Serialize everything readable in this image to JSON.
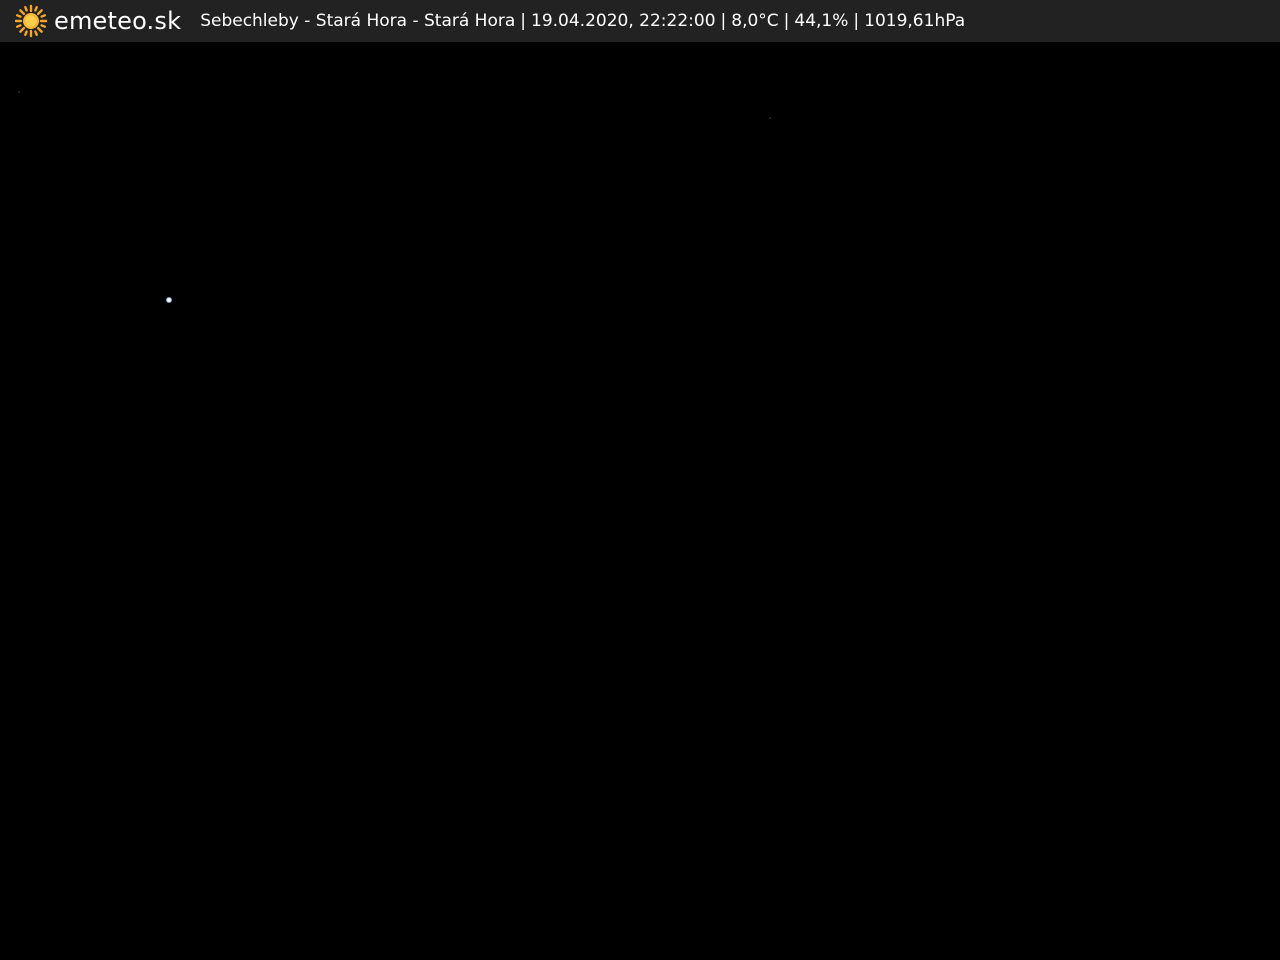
{
  "overlay": {
    "brand": "emeteo.sk",
    "location": "Sebechleby - Stará Hora - Stará Hora",
    "datetime": "19.04.2020, 22:22:00",
    "temperature": "8,0°C",
    "humidity": "44,1%",
    "pressure": "1019,61hPa",
    "separator": "|",
    "logo_icon": "sun-icon",
    "colors": {
      "bar_background": "#222222",
      "text": "#ffffff",
      "sun": "#f5a623"
    }
  },
  "scene": {
    "description_icon": "night-sky",
    "background": "#000000"
  }
}
